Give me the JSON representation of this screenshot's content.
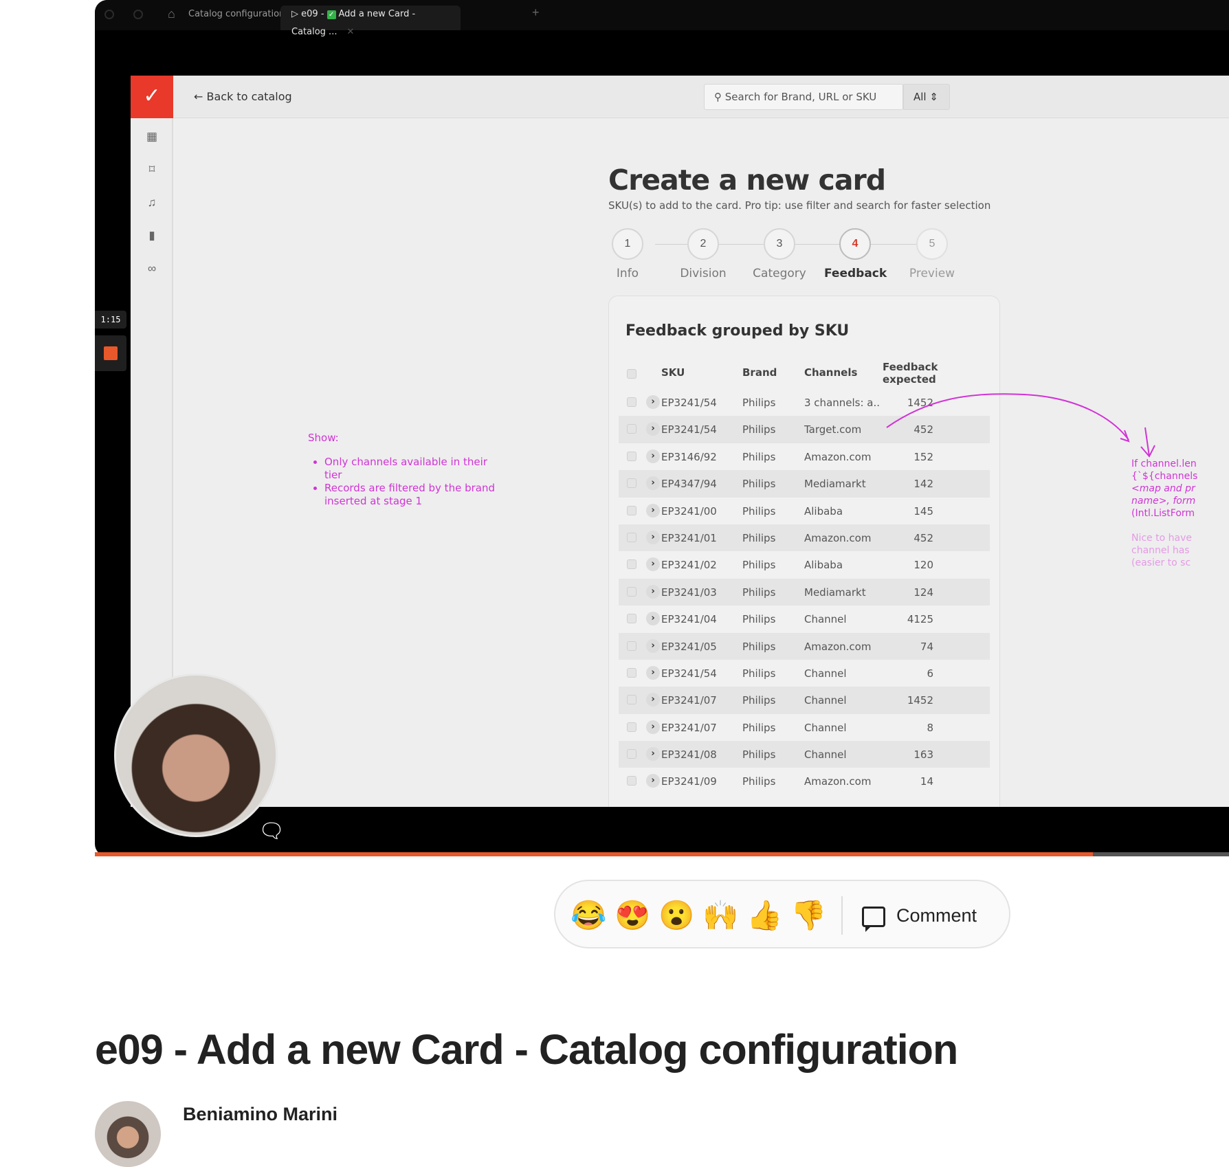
{
  "browser": {
    "tabs": [
      {
        "label": "Catalog configuration"
      },
      {
        "label": "e09 -",
        "label_after_icon": "Add a new Card - Catalog ...",
        "status_icon": "check-icon"
      }
    ],
    "home_icon": "home-icon"
  },
  "app": {
    "back_label": "Back to catalog",
    "search_placeholder": "Search for Brand, URL or SKU",
    "search_scope": "All",
    "rail_icons": [
      "grid-icon",
      "bookmark-icon",
      "bell-icon",
      "barcode-icon",
      "link-icon"
    ],
    "title": "Create a new card",
    "subtitle": "SKU(s) to add to the card. Pro tip: use filter and search for faster selection",
    "steps": [
      {
        "number": "1",
        "label": "Info"
      },
      {
        "number": "2",
        "label": "Division"
      },
      {
        "number": "3",
        "label": "Category"
      },
      {
        "number": "4",
        "label": "Feedback",
        "active": true
      },
      {
        "number": "5",
        "label": "Preview"
      }
    ],
    "table": {
      "title": "Feedback grouped by SKU",
      "columns": [
        "SKU",
        "Brand",
        "Channels",
        "Feedback expected"
      ],
      "rows": [
        [
          "EP3241/54",
          "Philips",
          "3 channels: a..",
          "1452"
        ],
        [
          "EP3241/54",
          "Philips",
          "Target.com",
          "452"
        ],
        [
          "EP3146/92",
          "Philips",
          "Amazon.com",
          "152"
        ],
        [
          "EP4347/94",
          "Philips",
          "Mediamarkt",
          "142"
        ],
        [
          "EP3241/00",
          "Philips",
          "Alibaba",
          "145"
        ],
        [
          "EP3241/01",
          "Philips",
          "Amazon.com",
          "452"
        ],
        [
          "EP3241/02",
          "Philips",
          "Alibaba",
          "120"
        ],
        [
          "EP3241/03",
          "Philips",
          "Mediamarkt",
          "124"
        ],
        [
          "EP3241/04",
          "Philips",
          "Channel",
          "4125"
        ],
        [
          "EP3241/05",
          "Philips",
          "Amazon.com",
          "74"
        ],
        [
          "EP3241/54",
          "Philips",
          "Channel",
          "6"
        ],
        [
          "EP3241/07",
          "Philips",
          "Channel",
          "1452"
        ],
        [
          "EP3241/07",
          "Philips",
          "Channel",
          "8"
        ],
        [
          "EP3241/08",
          "Philips",
          "Channel",
          "163"
        ],
        [
          "EP3241/09",
          "Philips",
          "Amazon.com",
          "14"
        ]
      ]
    },
    "note_left": {
      "heading": "Show:",
      "items": [
        "Only channels available in their tier",
        "Records are filtered by the brand inserted at stage 1"
      ]
    },
    "note_right": {
      "lines": [
        "If channel.len",
        "{`${channels",
        "<map and pr",
        "name>, form",
        "(Intl.ListForm"
      ],
      "lines_dim": [
        "Nice to have",
        "channel has",
        "(easier to sc"
      ]
    }
  },
  "recorder": {
    "timer": "1:15",
    "progress": 0.88
  },
  "reactions": {
    "emojis": [
      "😂",
      "😍",
      "😮",
      "🙌",
      "👍",
      "👎"
    ],
    "comment_label": "Comment"
  },
  "video": {
    "title": "e09 - Add a new Card - Catalog configuration",
    "author": "Beniamino Marini"
  },
  "colors": {
    "accent": "#e8582b",
    "brand_red": "#e8392a",
    "annotation": "#d133d6"
  }
}
